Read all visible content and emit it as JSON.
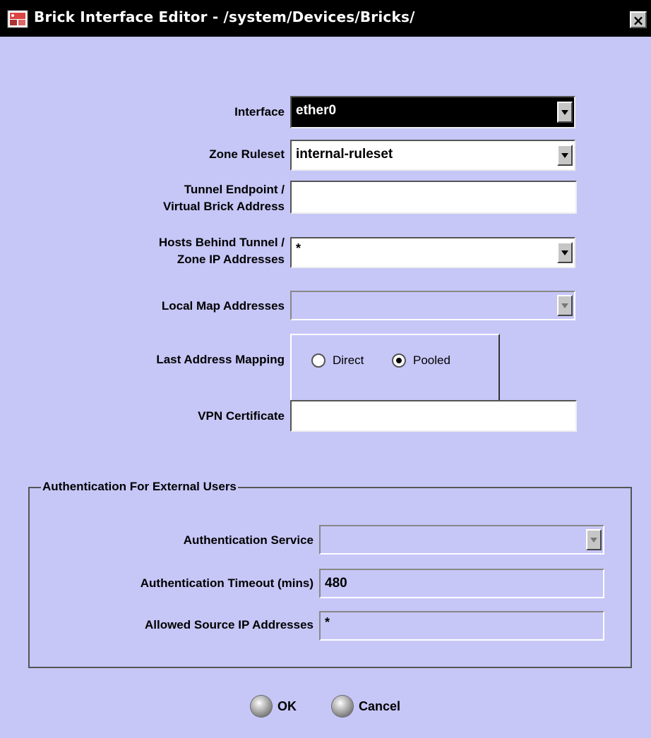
{
  "window": {
    "title": "Brick Interface Editor - /system/Devices/Bricks/",
    "close_label": "×"
  },
  "form": {
    "interface": {
      "label": "Interface",
      "value": "ether0"
    },
    "zone_ruleset": {
      "label": "Zone Ruleset",
      "value": "internal-ruleset"
    },
    "tunnel_endpoint": {
      "label_line1": "Tunnel Endpoint /",
      "label_line2": "Virtual Brick Address",
      "value": ""
    },
    "hosts_behind_tunnel": {
      "label_line1": "Hosts Behind Tunnel /",
      "label_line2": "Zone IP Addresses",
      "value": "*"
    },
    "local_map": {
      "label": "Local Map Addresses",
      "value": ""
    },
    "last_address_mapping": {
      "label": "Last Address Mapping",
      "options": [
        "Direct",
        "Pooled"
      ],
      "selected": "Pooled"
    },
    "vpn_certificate": {
      "label": "VPN Certificate",
      "value": ""
    }
  },
  "auth_group": {
    "title": "Authentication For External Users",
    "service": {
      "label": "Authentication Service",
      "value": ""
    },
    "timeout": {
      "label": "Authentication Timeout (mins)",
      "value": "480"
    },
    "allowed_ips": {
      "label": "Allowed Source IP Addresses",
      "value": "*"
    }
  },
  "buttons": {
    "ok": "OK",
    "cancel": "Cancel"
  },
  "colors": {
    "background": "#c6c6f7",
    "titlebar": "#000000"
  },
  "icons": {
    "app": "brick-app-icon",
    "close": "close-icon"
  }
}
